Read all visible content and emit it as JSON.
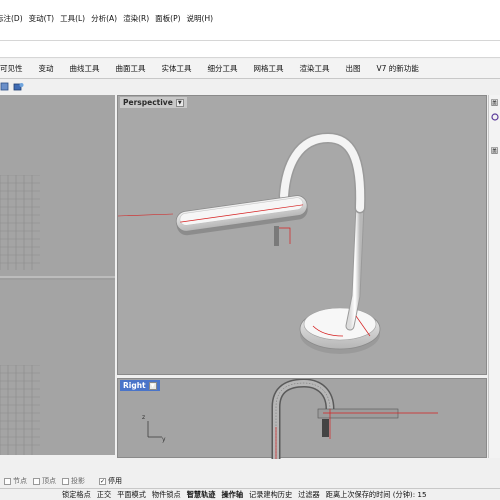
{
  "menu": {
    "items": [
      "标注(D)",
      "变动(T)",
      "工具(L)",
      "分析(A)",
      "渲染(R)",
      "面板(P)",
      "说明(H)"
    ]
  },
  "tabs": [
    "可见性",
    "变动",
    "曲线工具",
    "曲面工具",
    "实体工具",
    "细分工具",
    "网格工具",
    "渲染工具",
    "出图",
    "V7 的新功能"
  ],
  "viewports": {
    "perspective": {
      "label": "Perspective"
    },
    "right": {
      "label": "Right"
    }
  },
  "osnap": {
    "items": [
      {
        "label": "节点",
        "checked": false
      },
      {
        "label": "顶点",
        "checked": false
      },
      {
        "label": "投影",
        "checked": false
      },
      {
        "label": "停用",
        "checked": true
      }
    ]
  },
  "statusbar": {
    "items": [
      {
        "label": "锁定格点",
        "bold": false
      },
      {
        "label": "正交",
        "bold": false
      },
      {
        "label": "平面模式",
        "bold": false
      },
      {
        "label": "物件锁点",
        "bold": false
      },
      {
        "label": "智慧轨迹",
        "bold": true
      },
      {
        "label": "操作轴",
        "bold": true
      },
      {
        "label": "记录建构历史",
        "bold": false
      },
      {
        "label": "过滤器",
        "bold": false
      },
      {
        "label": "距离上次保存的时间 (分钟): 15",
        "bold": false
      }
    ]
  },
  "colors": {
    "viewport_bg": "#a8a8a8",
    "active_label": "#4a74c9",
    "curve_red": "#d62020"
  }
}
